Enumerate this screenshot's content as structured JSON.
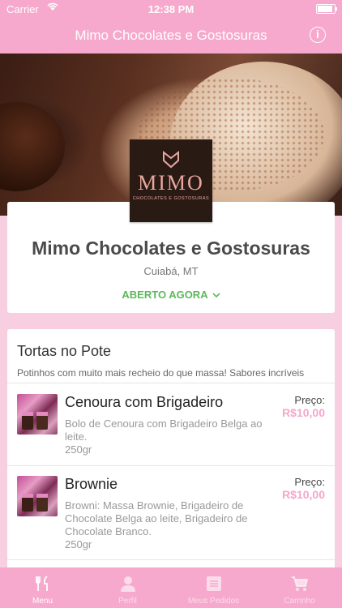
{
  "status_bar": {
    "carrier": "Carrier",
    "time": "12:38 PM"
  },
  "navbar": {
    "title": "Mimo Chocolates e Gostosuras",
    "info_icon": "info-icon"
  },
  "store": {
    "logo_text": "MIMO",
    "logo_tagline": "CHOCOLATES E GOSTOSURAS",
    "name": "Mimo Chocolates e Gostosuras",
    "city": "Cuiabá, MT",
    "status": "ABERTO AGORA"
  },
  "category": {
    "title": "Tortas no Pote",
    "description": "Potinhos com muito mais recheio do que massa! Sabores incríveis"
  },
  "items": [
    {
      "name": "Cenoura com Brigadeiro",
      "description": "Bolo de Cenoura com Brigadeiro Belga ao leite.",
      "size": "250gr",
      "price_label": "Preço:",
      "price": "R$10,00"
    },
    {
      "name": "Brownie",
      "description": "Browni: Massa Brownie, Brigadeiro de Chocolate Belga ao leite, Brigadeiro de Chocolate Branco.",
      "size": "250gr",
      "price_label": "Preço:",
      "price": "R$10,00"
    }
  ],
  "tabs": [
    {
      "label": "Menu",
      "icon": "fork-knife-icon"
    },
    {
      "label": "Perfil",
      "icon": "person-icon"
    },
    {
      "label": "Meus Pedidos",
      "icon": "list-icon"
    },
    {
      "label": "Carrinho",
      "icon": "cart-icon"
    }
  ],
  "colors": {
    "brand_pink": "#f6a9cc",
    "background": "#f8cfe1",
    "open_green": "#5cb85c",
    "price_pink": "#f5a6cc"
  }
}
